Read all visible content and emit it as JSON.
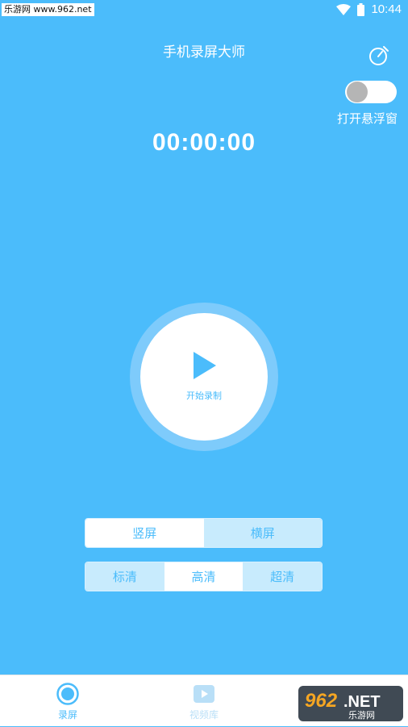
{
  "status_bar": {
    "watermark": "乐游网 www.962.net",
    "time": "10:44"
  },
  "header": {
    "title": "手机录屏大师",
    "timer_icon": "timer-icon"
  },
  "floating_window": {
    "label": "打开悬浮窗",
    "enabled": false
  },
  "timer": {
    "display": "00:00:00"
  },
  "record_button": {
    "label": "开始录制",
    "icon": "play-icon"
  },
  "orientation": {
    "options": [
      "竖屏",
      "横屏"
    ],
    "selected": "竖屏"
  },
  "quality": {
    "options": [
      "标清",
      "高清",
      "超清"
    ],
    "selected": "高清"
  },
  "bottom_nav": {
    "items": [
      {
        "label": "录屏",
        "icon": "record-icon",
        "active": true
      },
      {
        "label": "视频库",
        "icon": "video-library-icon",
        "active": false
      }
    ]
  },
  "watermark": {
    "text_main": "962.NET",
    "text_sub": "乐游网"
  },
  "colors": {
    "background": "#4bbcfb",
    "accent": "#4bbcfb",
    "inactive_segment": "#c8ebfd"
  }
}
